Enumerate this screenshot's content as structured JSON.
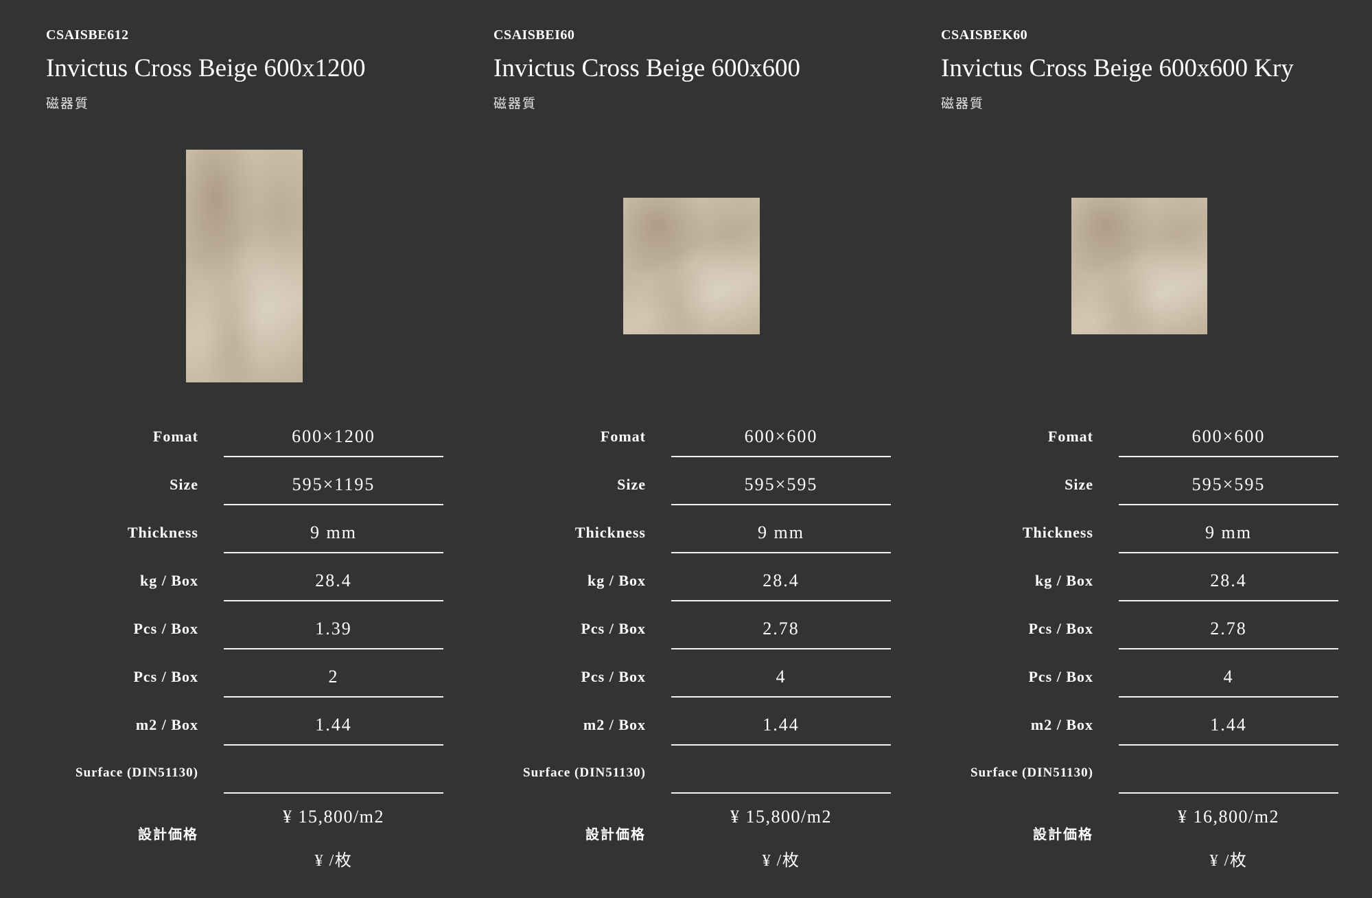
{
  "products": [
    {
      "code": "CSAISBE612",
      "name": "Invictus Cross Beige 600x1200",
      "material": "磁器質",
      "specs": [
        {
          "label": "Fomat",
          "value": "600×1200"
        },
        {
          "label": "Size",
          "value": "595×1195"
        },
        {
          "label": "Thickness",
          "value": "9 mm"
        },
        {
          "label": "kg / Box",
          "value": "28.4"
        },
        {
          "label": "Pcs / Box",
          "value": "1.39"
        },
        {
          "label": "Pcs / Box",
          "value": "2"
        },
        {
          "label": "m2 / Box",
          "value": "1.44"
        },
        {
          "label": "Surface (DIN51130)",
          "value": ""
        }
      ],
      "price_label": "設計価格",
      "price_per_m2": "¥ 15,800/m2",
      "price_per_piece": "¥ /枚"
    },
    {
      "code": "CSAISBEI60",
      "name": "Invictus Cross Beige 600x600",
      "material": "磁器質",
      "specs": [
        {
          "label": "Fomat",
          "value": "600×600"
        },
        {
          "label": "Size",
          "value": "595×595"
        },
        {
          "label": "Thickness",
          "value": "9 mm"
        },
        {
          "label": "kg / Box",
          "value": "28.4"
        },
        {
          "label": "Pcs / Box",
          "value": "2.78"
        },
        {
          "label": "Pcs / Box",
          "value": "4"
        },
        {
          "label": "m2 / Box",
          "value": "1.44"
        },
        {
          "label": "Surface (DIN51130)",
          "value": ""
        }
      ],
      "price_label": "設計価格",
      "price_per_m2": "¥ 15,800/m2",
      "price_per_piece": "¥ /枚"
    },
    {
      "code": "CSAISBEK60",
      "name": "Invictus Cross Beige 600x600 Kry",
      "material": "磁器質",
      "specs": [
        {
          "label": "Fomat",
          "value": "600×600"
        },
        {
          "label": "Size",
          "value": "595×595"
        },
        {
          "label": "Thickness",
          "value": "9 mm"
        },
        {
          "label": "kg / Box",
          "value": "28.4"
        },
        {
          "label": "Pcs / Box",
          "value": "2.78"
        },
        {
          "label": "Pcs / Box",
          "value": "4"
        },
        {
          "label": "m2 / Box",
          "value": "1.44"
        },
        {
          "label": "Surface (DIN51130)",
          "value": ""
        }
      ],
      "price_label": "設計価格",
      "price_per_m2": "¥ 16,800/m2",
      "price_per_piece": "¥ /枚"
    }
  ]
}
